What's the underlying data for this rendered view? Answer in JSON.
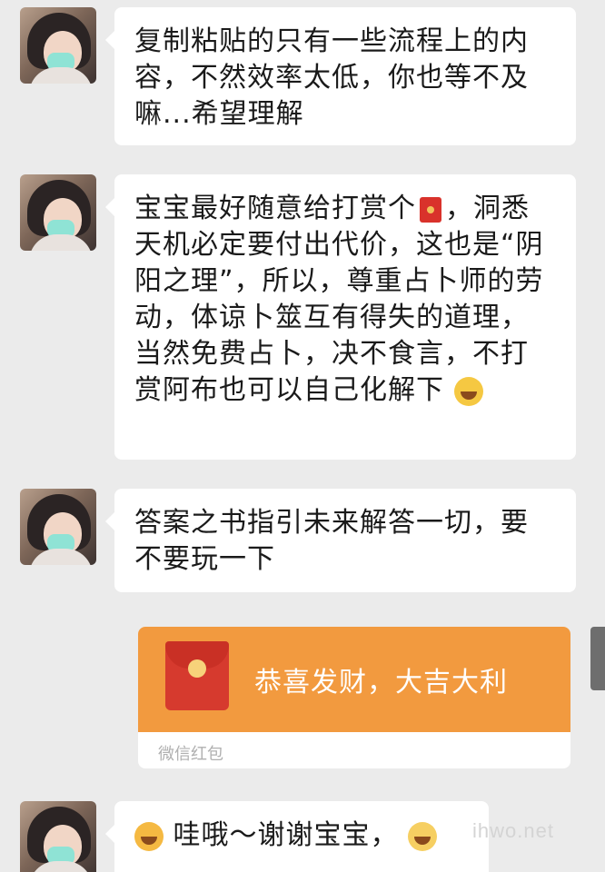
{
  "messages": [
    {
      "text": "复制粘贴的只有一些流程上的内容，不然效率太低，你也等不及嘛...希望理解"
    },
    {
      "text_a": "宝宝最好随意给打赏个",
      "text_b": "，洞悉天机必定要付出代价，这也是“阴阳之理”，所以，尊重占卜师的劳动，体谅卜筮互有得失的道理，当然免费占卜，决不食言，不打赏阿布也可以自己化解下"
    },
    {
      "text": "答案之书指引未来解答一切，要不要玩一下"
    },
    {
      "text": "哇哦～谢谢宝宝，"
    }
  ],
  "red_packet": {
    "greeting": "恭喜发财，大吉大利",
    "label": "微信红包"
  },
  "watermark": "ihwo.net",
  "icons": [
    "avatar",
    "red-packet-icon",
    "grin-emoji-icon",
    "heart-eyes-emoji-icon",
    "laugh-emoji-icon"
  ],
  "colors": {
    "background": "#ebebeb",
    "bubble": "#ffffff",
    "red_packet": "#f29a3f",
    "packet_icon": "#d63a2e"
  }
}
